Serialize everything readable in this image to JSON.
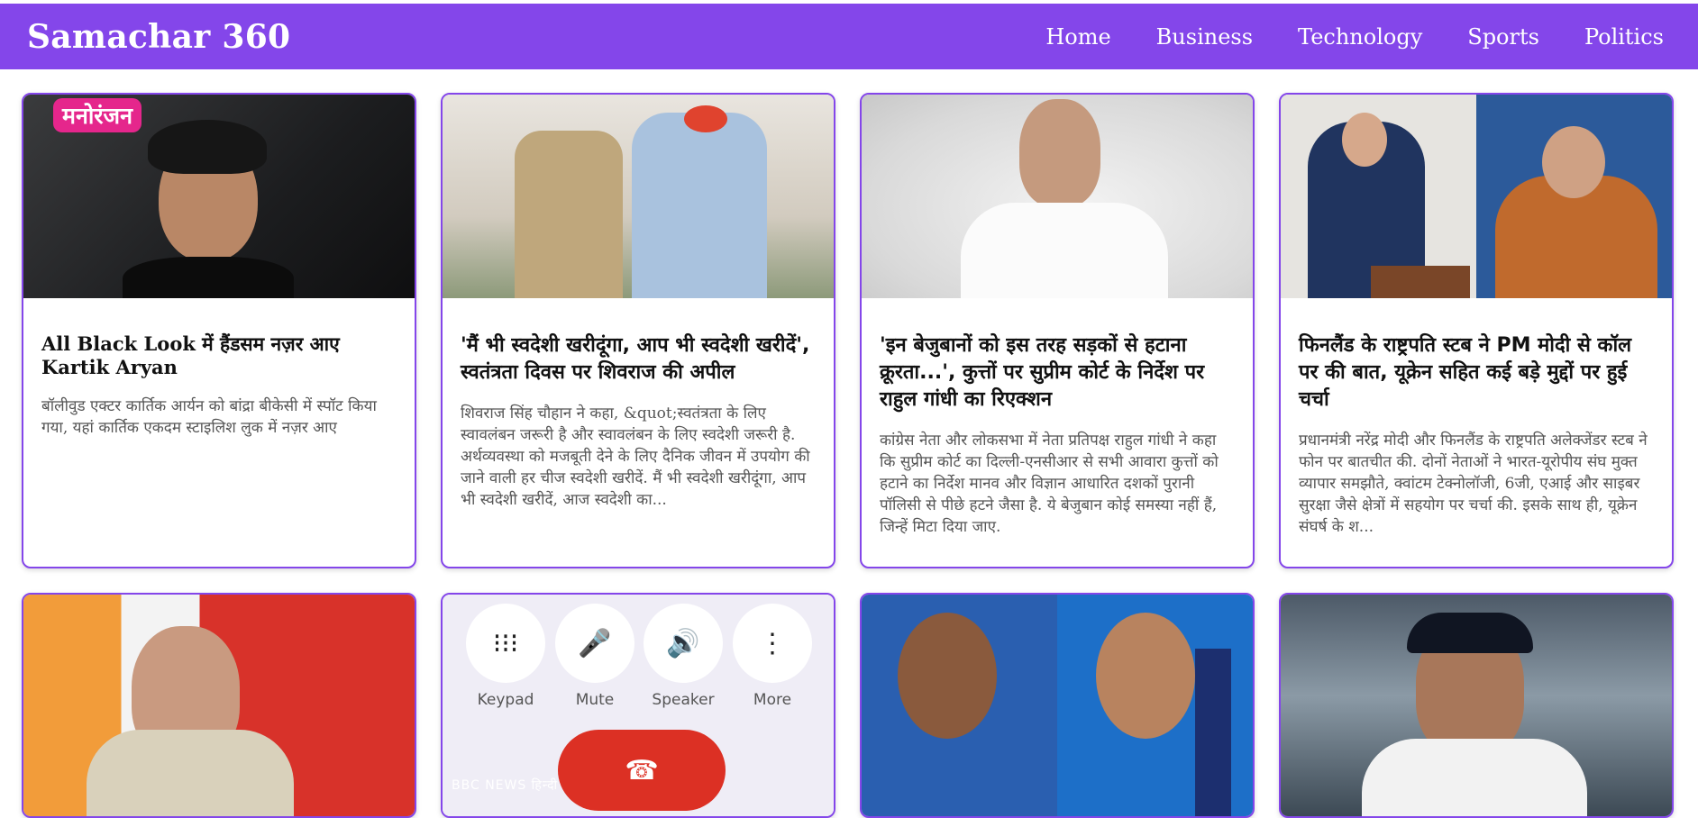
{
  "header": {
    "brand": "Samachar 360",
    "nav": [
      "Home",
      "Business",
      "Technology",
      "Sports",
      "Politics"
    ]
  },
  "colors": {
    "accent": "#8446ea",
    "badge": "#e5268c",
    "hangup": "#dc3024"
  },
  "cards": [
    {
      "badge": "मनोरंजन",
      "title": "All Black Look में हैंडसम नज़र आए Kartik Aryan",
      "description": "बॉलीवुड एक्टर कार्तिक आर्यन को बांद्रा बीकेसी में स्पॉट किया गया, यहां कार्तिक एकदम स्टाइलिश लुक में नज़र आए"
    },
    {
      "title": "'मैं भी स्वदेशी खरीदूंगा, आप भी स्वदेशी खरीदें', स्वतंत्रता दिवस पर शिवराज की अपील",
      "description": "शिवराज सिंह चौहान ने कहा, &quot;स्वतंत्रता के लिए स्वावलंबन जरूरी है और स्वावलंबन के लिए स्वदेशी जरूरी है. अर्थव्यवस्था को मजबूती देने के लिए दैनिक जीवन में उपयोग की जाने वाली हर चीज स्वदेशी खरीदें. मैं भी स्वदेशी खरीदूंगा, आप भी स्वदेशी खरीदें, आज स्वदेशी का..."
    },
    {
      "title": "'इन बेजुबानों को इस तरह सड़कों से हटाना क्रूरता...', कुत्तों पर सुप्रीम कोर्ट के निर्देश पर राहुल गांधी का रिएक्शन",
      "description": "कांग्रेस नेता और लोकसभा में नेता प्रतिपक्ष राहुल गांधी ने कहा कि सुप्रीम कोर्ट का दिल्ली-एनसीआर से सभी आवारा कुत्तों को हटाने का निर्देश मानव और विज्ञान आधारित दशकों पुरानी पॉलिसी से पीछे हटने जैसा है. ये बेजुबान कोई समस्या नहीं हैं, जिन्हें मिटा दिया जाए."
    },
    {
      "title": "फिनलैंड के राष्ट्रपति स्टब ने PM मोदी से कॉल पर की बात, यूक्रेन सहित कई बड़े मुद्दों पर हुई चर्चा",
      "description": "प्रधानमंत्री नरेंद्र मोदी और फिनलैंड के राष्ट्रपति अलेक्जेंडर स्टब ने फोन पर बातचीत की. दोनों नेताओं ने भारत-यूरोपीय संघ मुक्त व्यापार समझौते, क्वांटम टेक्नोलॉजी, 6जी, एआई और साइबर सुरक्षा जैसे क्षेत्रों में सहयोग पर चर्चा की. इसके साथ ही, यूक्रेन संघर्ष के श..."
    }
  ],
  "row2": {
    "phone": {
      "buttons": [
        "Keypad",
        "Mute",
        "Speaker",
        "More"
      ],
      "watermark": "BBC NEWS हिन्दी"
    }
  }
}
